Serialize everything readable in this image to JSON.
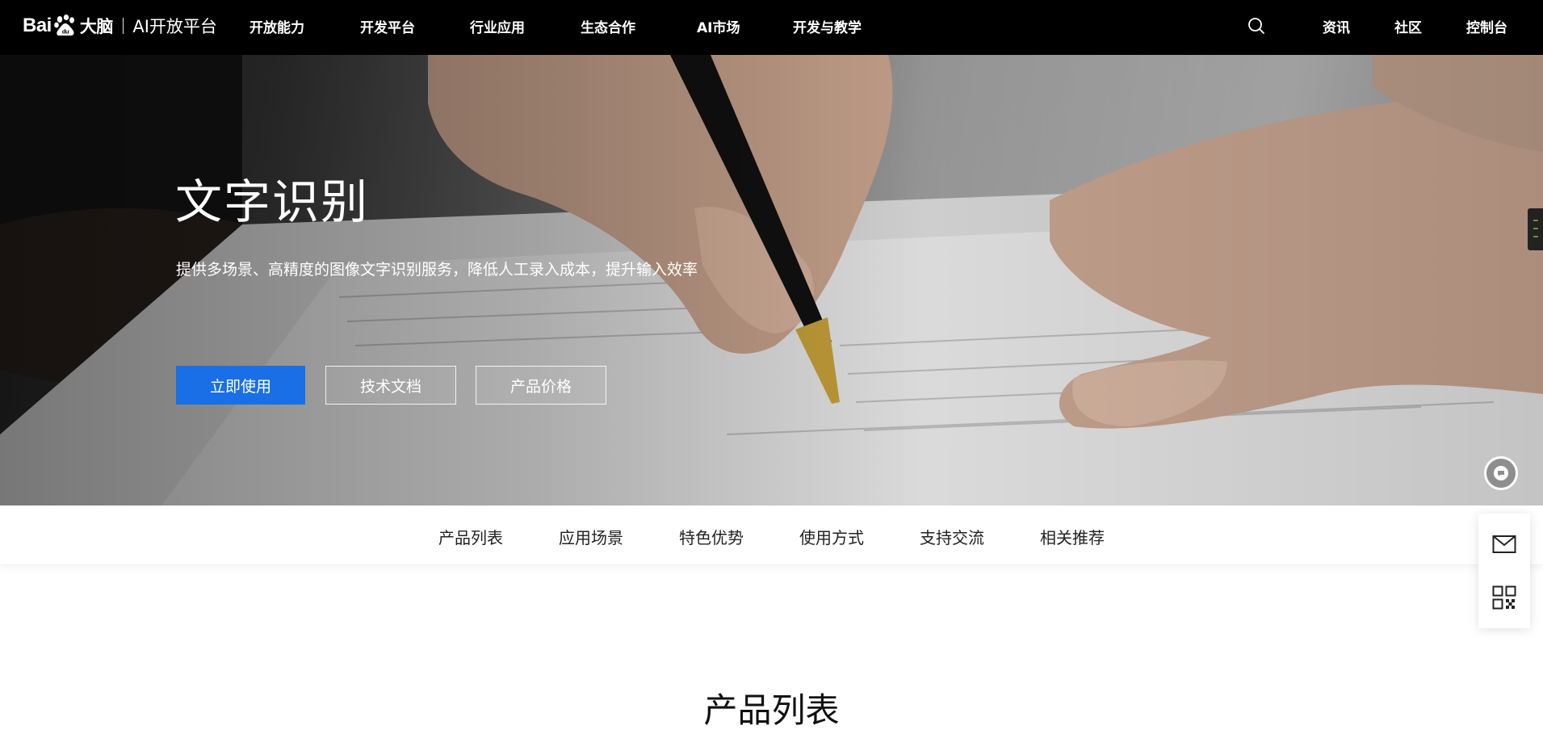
{
  "header": {
    "logo": {
      "brand": "Bai",
      "brand_suffix": "大脑",
      "platform": "AI开放平台"
    },
    "nav_items": [
      {
        "label": "开放能力"
      },
      {
        "label": "开发平台"
      },
      {
        "label": "行业应用"
      },
      {
        "label": "生态合作"
      },
      {
        "label": "AI市场"
      },
      {
        "label": "开发与教学"
      }
    ],
    "right_links": [
      {
        "label": "资讯"
      },
      {
        "label": "社区"
      },
      {
        "label": "控制台"
      }
    ],
    "search_icon": "search-icon"
  },
  "hero": {
    "title": "文字识别",
    "subtitle": "提供多场景、高精度的图像文字识别服务，降低人工录入成本，提升输入效率",
    "buttons": {
      "primary": "立即使用",
      "docs": "技术文档",
      "price": "产品价格"
    },
    "chat_icon": "chat-bubble-icon"
  },
  "subnav": {
    "items": [
      {
        "label": "产品列表"
      },
      {
        "label": "应用场景"
      },
      {
        "label": "特色优势"
      },
      {
        "label": "使用方式"
      },
      {
        "label": "支持交流"
      },
      {
        "label": "相关推荐"
      }
    ]
  },
  "float_toolbar": {
    "icons": [
      "mail-icon",
      "qr-code-icon"
    ]
  },
  "main": {
    "section_title": "产品列表"
  },
  "colors": {
    "nav_background": "#000000",
    "primary_button": "#1a6fe6",
    "text_dark": "#222222"
  }
}
